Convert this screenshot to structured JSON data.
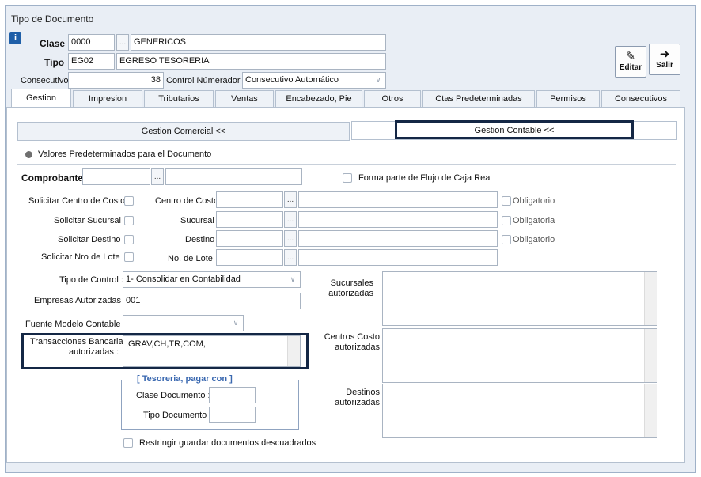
{
  "window": {
    "title": "Tipo de Documento"
  },
  "header": {
    "clase": {
      "label": "Clase",
      "code": "0000",
      "lookup": "...",
      "name": "GENERICOS"
    },
    "tipo": {
      "label": "Tipo",
      "code": "EG02",
      "name": "EGRESO TESORERIA"
    },
    "consecutivo": {
      "label": "Consecutivo",
      "value": "38"
    },
    "control_numerador": {
      "label": "Control Númerador :",
      "value": "Consecutivo Automático"
    }
  },
  "toolbar": {
    "edit_label": "Editar",
    "exit_label": "Salir"
  },
  "tabs": [
    {
      "label": "Gestion"
    },
    {
      "label": "Impresion"
    },
    {
      "label": "Tributarios"
    },
    {
      "label": "Ventas"
    },
    {
      "label": "Encabezado, Pie"
    },
    {
      "label": "Otros"
    },
    {
      "label": "Ctas Predeterminadas"
    },
    {
      "label": "Permisos"
    },
    {
      "label": "Consecutivos"
    }
  ],
  "subtabs": {
    "comercial": "Gestion Comercial <<",
    "contable": "Gestion Contable <<"
  },
  "section_title": "Valores Predeterminados para el Documento",
  "comprobante": {
    "label": "Comprobante",
    "lookup": "..."
  },
  "flujo_caja": {
    "label": "Forma parte de Flujo de Caja  Real"
  },
  "rows": {
    "centro_costo": {
      "solicitar": "Solicitar Centro de Costo",
      "label": "Centro de Costo",
      "oblig": "Obligatorio"
    },
    "sucursal": {
      "solicitar": "Solicitar Sucursal",
      "label": "Sucursal",
      "oblig": "Obligatoria"
    },
    "destino": {
      "solicitar": "Solicitar Destino",
      "label": "Destino",
      "oblig": "Obligatorio"
    },
    "lote": {
      "solicitar": "Solicitar Nro de  Lote",
      "label": "No. de Lote"
    }
  },
  "tipo_control": {
    "label": "Tipo de Control :",
    "value": "1- Consolidar en Contabilidad"
  },
  "empresas": {
    "label": "Empresas Autorizadas :",
    "value": "001"
  },
  "fuente_modelo": {
    "label": "Fuente Modelo Contable :"
  },
  "transacciones": {
    "label1": "Transacciones Bancarias",
    "label2": "autorizadas :",
    "value": ",GRAV,CH,TR,COM,"
  },
  "sucursales_aut": {
    "label1": "Sucursales",
    "label2": "autorizadas"
  },
  "centros_aut": {
    "label1": "Centros Costo",
    "label2": "autorizadas"
  },
  "destinos_aut": {
    "label1": "Destinos",
    "label2": "autorizadas"
  },
  "tesoreria": {
    "title": "[ Tesoreria, pagar con ]",
    "clase_doc": "Clase Documento :",
    "tipo_doc": "Tipo Documento :"
  },
  "restringir": {
    "label": "Restringir guardar documentos descuadrados"
  }
}
